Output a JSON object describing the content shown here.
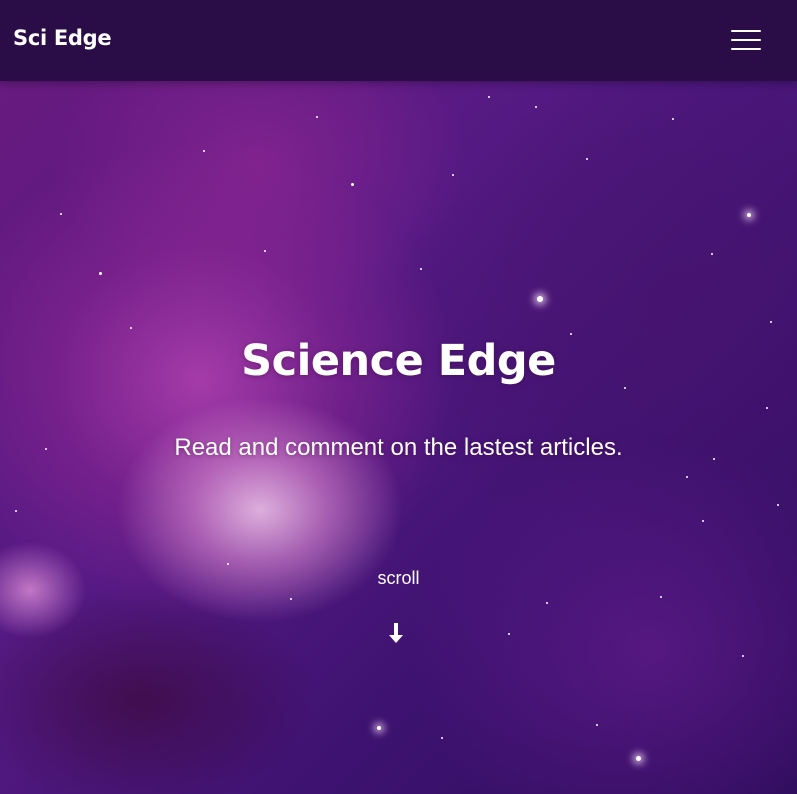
{
  "header": {
    "brand": "Sci Edge",
    "menu_icon": "hamburger-menu-icon"
  },
  "hero": {
    "title": "Science Edge",
    "subtitle": "Read and comment on the lastest articles.",
    "scroll_label": "scroll",
    "scroll_icon": "arrow-down-icon"
  },
  "colors": {
    "header_bg": "#2a0d47",
    "text": "#ffffff",
    "nebula_primary": "#6a1a7e",
    "nebula_highlight": "#f0c8eb"
  }
}
